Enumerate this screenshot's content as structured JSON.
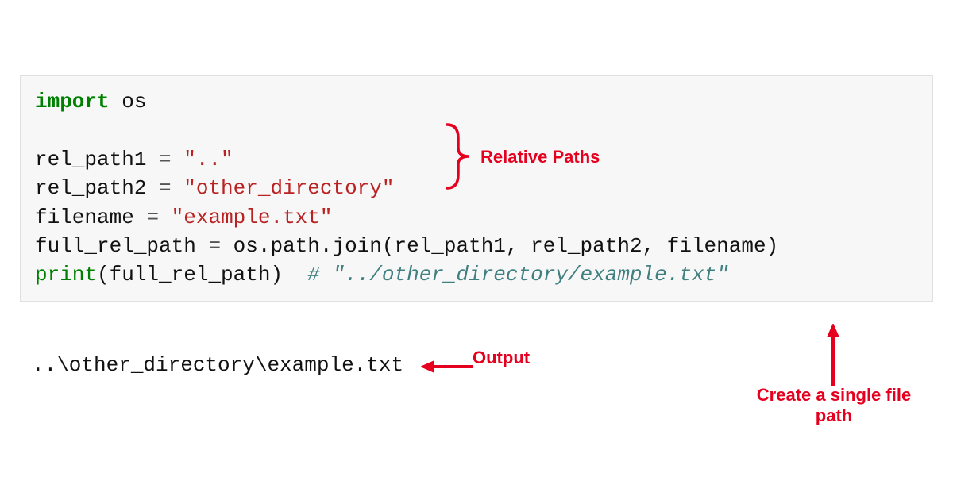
{
  "code": {
    "line1_kw": "import",
    "line1_mod": " os",
    "line2_var": "rel_path1 ",
    "line2_eq": "= ",
    "line2_str": "\"..\"",
    "line3_var": "rel_path2 ",
    "line3_eq": "= ",
    "line3_str": "\"other_directory\"",
    "line4_var": "filename ",
    "line4_eq": "= ",
    "line4_str": "\"example.txt\"",
    "line5_var": "full_rel_path ",
    "line5_eq": "= ",
    "line5_rest": "os.path.join(rel_path1, rel_path2, filename)",
    "line6_print": "print",
    "line6_args": "(full_rel_path)  ",
    "line6_comment": "# \"../other_directory/example.txt\""
  },
  "output": "..\\other_directory\\example.txt",
  "annotations": {
    "relative_paths": "Relative Paths",
    "output_label": "Output",
    "single_path": "Create a single file path"
  },
  "colors": {
    "annotation": "#e6001f",
    "keyword": "#008000",
    "string": "#ba2121",
    "comment": "#408080",
    "code_bg": "#f7f7f7"
  }
}
